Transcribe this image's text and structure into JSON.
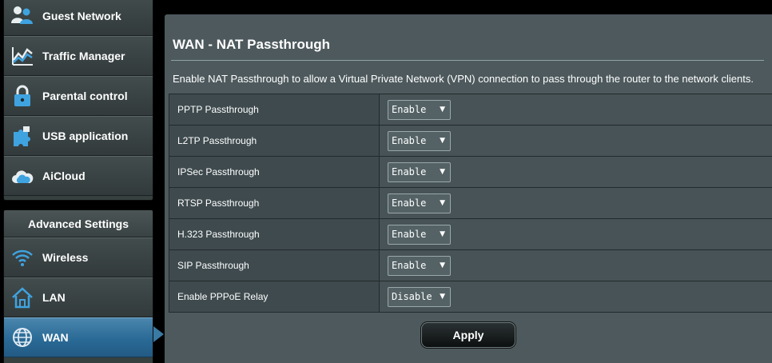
{
  "sidebar": {
    "general_items": [
      {
        "label": "Guest Network",
        "icon": "guest-network-icon"
      },
      {
        "label": "Traffic Manager",
        "icon": "traffic-manager-icon"
      },
      {
        "label": "Parental control",
        "icon": "lock-icon"
      },
      {
        "label": "USB application",
        "icon": "puzzle-icon"
      },
      {
        "label": "AiCloud",
        "icon": "cloud-icon"
      }
    ],
    "advanced_header": "Advanced Settings",
    "advanced_items": [
      {
        "label": "Wireless",
        "icon": "wifi-icon"
      },
      {
        "label": "LAN",
        "icon": "home-icon"
      },
      {
        "label": "WAN",
        "icon": "globe-icon",
        "active": true
      }
    ]
  },
  "main": {
    "title": "WAN - NAT Passthrough",
    "description": "Enable NAT Passthrough to allow a Virtual Private Network (VPN) connection to pass through the router to the network clients.",
    "rows": [
      {
        "label": "PPTP Passthrough",
        "value": "Enable"
      },
      {
        "label": "L2TP Passthrough",
        "value": "Enable"
      },
      {
        "label": "IPSec Passthrough",
        "value": "Enable"
      },
      {
        "label": "RTSP Passthrough",
        "value": "Enable"
      },
      {
        "label": "H.323 Passthrough",
        "value": "Enable"
      },
      {
        "label": "SIP Passthrough",
        "value": "Enable"
      },
      {
        "label": "Enable PPPoE Relay",
        "value": "Disable"
      }
    ],
    "apply_label": "Apply"
  },
  "colors": {
    "panel_bg": "#4d595d",
    "active_item": "#2a6a96",
    "sidebar_item": "#3a4344"
  }
}
